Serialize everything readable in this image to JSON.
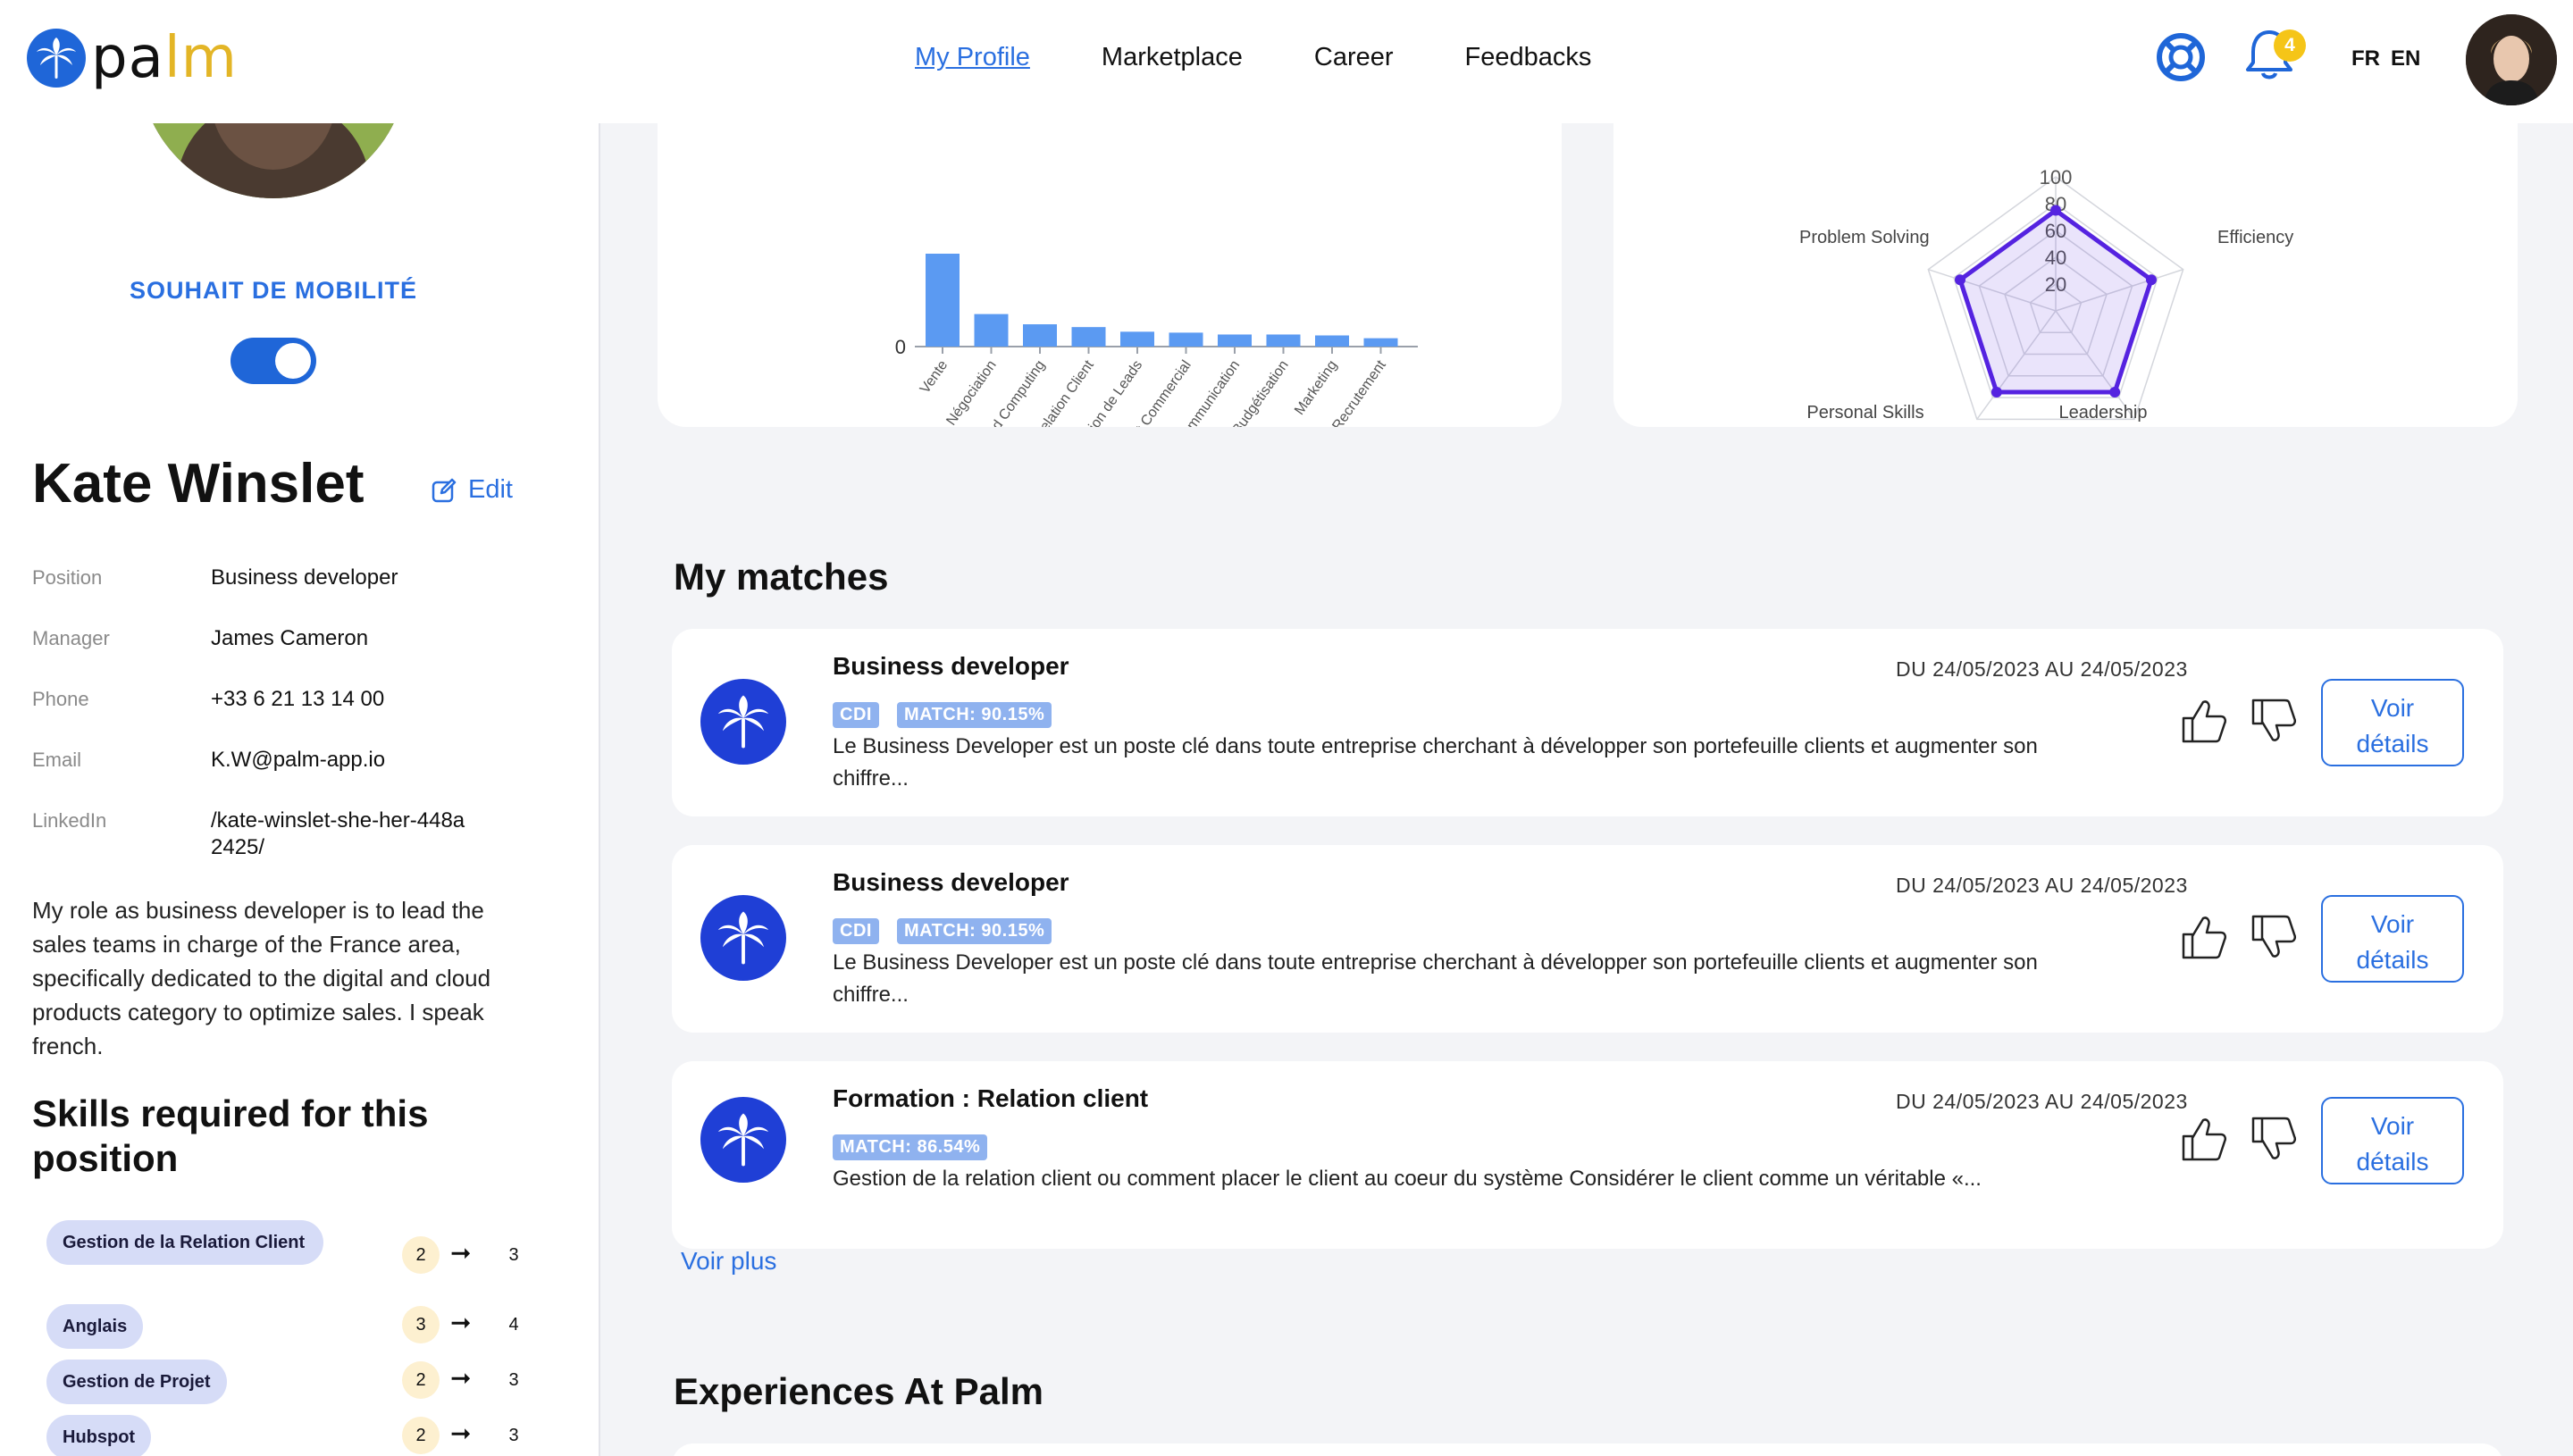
{
  "brand": {
    "logo_text_a": "pa",
    "logo_text_b": "lm",
    "primary": "#1f66d8",
    "accent": "#e3b526"
  },
  "nav": {
    "items": [
      "My Profile",
      "Marketplace",
      "Career",
      "Feedbacks"
    ],
    "active": "My Profile"
  },
  "header": {
    "notifications": "4",
    "lang_fr": "FR",
    "lang_en": "EN"
  },
  "sidebar": {
    "mobility_label": "SOUHAIT DE MOBILITÉ",
    "mobility_on": true,
    "name": "Kate Winslet",
    "edit_label": "Edit",
    "fields": [
      {
        "label": "Position",
        "value": "Business developer"
      },
      {
        "label": "Manager",
        "value": "James Cameron"
      },
      {
        "label": "Phone",
        "value": "+33 6 21 13 14 00"
      },
      {
        "label": "Email",
        "value": "K.W@palm-app.io"
      },
      {
        "label": "LinkedIn",
        "value": "/kate-winslet-she-her-448a2425/"
      }
    ],
    "bio": "My role as business developer is to lead the sales teams in charge of the France area, specifically dedicated to the digital and cloud products category to optimize sales. I speak french.",
    "skills_title": "Skills required for this position",
    "skills": [
      {
        "name": "Gestion de la Relation Client",
        "from": "2",
        "to": "3"
      },
      {
        "name": "Anglais",
        "from": "3",
        "to": "4"
      },
      {
        "name": "Gestion de Projet",
        "from": "2",
        "to": "3"
      },
      {
        "name": "Hubspot",
        "from": "2",
        "to": "3"
      }
    ]
  },
  "chart_data": [
    {
      "type": "bar",
      "categories": [
        "Vente",
        "Négociation",
        "Cloud Computing",
        "Gestion de la Relation Client",
        "Génération de Leads",
        "Développement Commercial",
        "Sens de la Communication",
        "Budgétisation",
        "Marketing",
        "Recrutement"
      ],
      "values": [
        100,
        35,
        24,
        21,
        16,
        15,
        13,
        13,
        12,
        9
      ],
      "y_tick_visible": "0"
    },
    {
      "type": "radar",
      "categories": [
        "Problem Solving",
        "Efficiency",
        "Leadership",
        "Personal Skills"
      ],
      "ticks": [
        "100",
        "80",
        "60",
        "40",
        "20"
      ],
      "values": [
        75,
        75,
        75,
        75,
        75
      ],
      "color": "#5523e0"
    }
  ],
  "matches_title": "My matches",
  "matches": [
    {
      "title": "Business developer",
      "date": "DU 24/05/2023 AU 24/05/2023",
      "tags": [
        "CDI",
        "MATCH: 90.15%"
      ],
      "description": "Le Business Developer est un poste clé dans toute entreprise cherchant à développer son portefeuille clients et augmenter son chiffre...",
      "button": "Voir détails"
    },
    {
      "title": "Business developer",
      "date": "DU 24/05/2023 AU 24/05/2023",
      "tags": [
        "CDI",
        "MATCH: 90.15%"
      ],
      "description": "Le Business Developer est un poste clé dans toute entreprise cherchant à développer son portefeuille clients et augmenter son chiffre...",
      "button": "Voir détails"
    },
    {
      "title": "Formation : Relation client",
      "date": "DU 24/05/2023 AU 24/05/2023",
      "tags": [
        "MATCH: 86.54%"
      ],
      "description": "Gestion de la relation client ou comment placer le client au coeur du système Considérer le client comme un véritable «...",
      "button": "Voir détails"
    }
  ],
  "voir_plus": "Voir plus",
  "experiences_title": "Experiences At Palm"
}
